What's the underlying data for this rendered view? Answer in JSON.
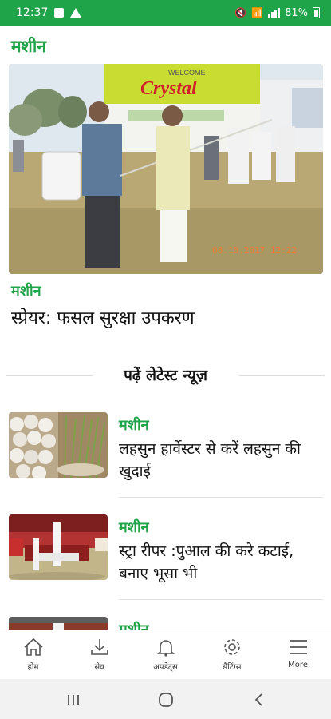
{
  "status": {
    "time": "12:37",
    "battery": "81%"
  },
  "app": {
    "title": "मशीन"
  },
  "hero": {
    "category": "मशीन",
    "title": "स्प्रेयर: फसल सुरक्षा उपकरण",
    "banner_top": "WELCOME",
    "banner_brand": "Crystal",
    "timestamp": "08.10.2017 12:22"
  },
  "latest": {
    "heading": "पढ़ें लेटेस्ट न्यूज़"
  },
  "news": [
    {
      "category": "मशीन",
      "title": "लहसुन हार्वेस्टर से करें लहसुन की खुदाई"
    },
    {
      "category": "मशीन",
      "title": "स्ट्रा रीपर :पुआल की करे कटाई, बनाए भूसा भी"
    },
    {
      "category": "मशीन",
      "title": ""
    }
  ],
  "bottom_nav": [
    {
      "label": "होम",
      "icon": "home-icon"
    },
    {
      "label": "सेव",
      "icon": "download-icon"
    },
    {
      "label": "अपडेट्स",
      "icon": "bell-icon"
    },
    {
      "label": "सैटिंग्स",
      "icon": "gear-icon"
    },
    {
      "label": "More",
      "icon": "menu-icon"
    }
  ],
  "colors": {
    "accent": "#1fa44a",
    "status_bar": "#1fa44a"
  }
}
